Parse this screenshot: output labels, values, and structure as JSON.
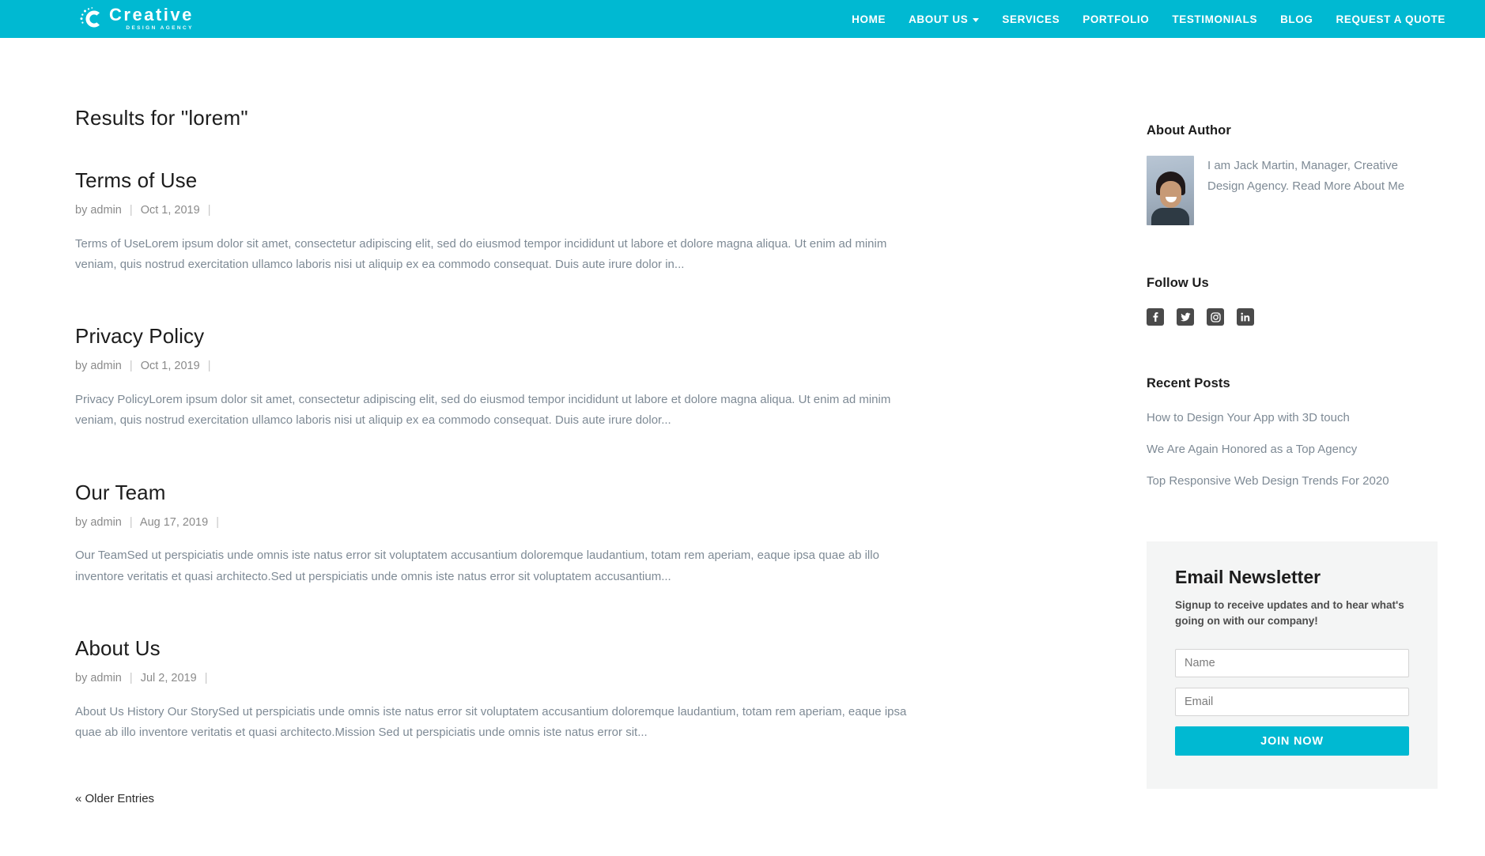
{
  "header": {
    "brand": {
      "name": "Creative",
      "tagline": "DESIGN AGENCY",
      "logo_icon": "creative-c-dots-logo"
    },
    "nav": [
      {
        "label": "HOME",
        "has_dropdown": false
      },
      {
        "label": "ABOUT US",
        "has_dropdown": true
      },
      {
        "label": "SERVICES",
        "has_dropdown": false
      },
      {
        "label": "PORTFOLIO",
        "has_dropdown": false
      },
      {
        "label": "TESTIMONIALS",
        "has_dropdown": false
      },
      {
        "label": "BLOG",
        "has_dropdown": false
      },
      {
        "label": "REQUEST A QUOTE",
        "has_dropdown": false
      }
    ],
    "background_color": "#00b9d2"
  },
  "main": {
    "results_heading": "Results for \"lorem\"",
    "results": [
      {
        "title": "Terms of Use",
        "author_prefix": "by",
        "author": "admin",
        "date": "Oct 1, 2019",
        "excerpt": "Terms of UseLorem ipsum dolor sit amet, consectetur adipiscing elit, sed do eiusmod tempor incididunt ut labore et dolore magna aliqua. Ut enim ad minim veniam, quis nostrud exercitation ullamco laboris nisi ut aliquip ex ea commodo consequat. Duis aute irure dolor in..."
      },
      {
        "title": "Privacy Policy",
        "author_prefix": "by",
        "author": "admin",
        "date": "Oct 1, 2019",
        "excerpt": "Privacy PolicyLorem ipsum dolor sit amet, consectetur adipiscing elit, sed do eiusmod tempor incididunt ut labore et dolore magna aliqua. Ut enim ad minim veniam, quis nostrud exercitation ullamco laboris nisi ut aliquip ex ea commodo consequat. Duis aute irure dolor..."
      },
      {
        "title": "Our Team",
        "author_prefix": "by",
        "author": "admin",
        "date": "Aug 17, 2019",
        "excerpt": "Our TeamSed ut perspiciatis unde omnis iste natus error sit voluptatem accusantium doloremque laudantium, totam rem aperiam, eaque ipsa quae ab illo inventore veritatis et quasi architecto.Sed ut perspiciatis unde omnis iste natus error sit voluptatem accusantium..."
      },
      {
        "title": "About Us",
        "author_prefix": "by",
        "author": "admin",
        "date": "Jul 2, 2019",
        "excerpt": "About Us History Our StorySed ut perspiciatis unde omnis iste natus error sit voluptatem accusantium doloremque laudantium, totam rem aperiam, eaque ipsa quae ab illo inventore veritatis et quasi architecto.Mission Sed ut perspiciatis unde omnis iste natus error sit..."
      }
    ],
    "pagination": {
      "older_entries_label": "« Older Entries"
    }
  },
  "sidebar": {
    "about_author": {
      "title": "About Author",
      "avatar_icon": "author-portrait-photo",
      "bio": "I am Jack Martin, Manager, Creative Design Agency. Read More About Me"
    },
    "follow_us": {
      "title": "Follow Us",
      "icons": [
        {
          "name": "facebook-icon",
          "label": "Facebook"
        },
        {
          "name": "twitter-icon",
          "label": "Twitter"
        },
        {
          "name": "instagram-icon",
          "label": "Instagram"
        },
        {
          "name": "linkedin-icon",
          "label": "LinkedIn"
        }
      ],
      "icon_background": "#4a4a4a"
    },
    "recent_posts": {
      "title": "Recent Posts",
      "items": [
        "How to Design Your App with 3D touch",
        "We Are Again Honored as a Top Agency",
        "Top Responsive Web Design Trends For 2020"
      ]
    },
    "newsletter": {
      "title": "Email Newsletter",
      "subtitle": "Signup to receive updates and to hear what's going on with our company!",
      "name_placeholder": "Name",
      "name_value": "",
      "email_placeholder": "Email",
      "email_value": "",
      "submit_label": "JOIN NOW",
      "submit_color": "#00b9d2",
      "panel_color": "#f4f5f5"
    }
  }
}
